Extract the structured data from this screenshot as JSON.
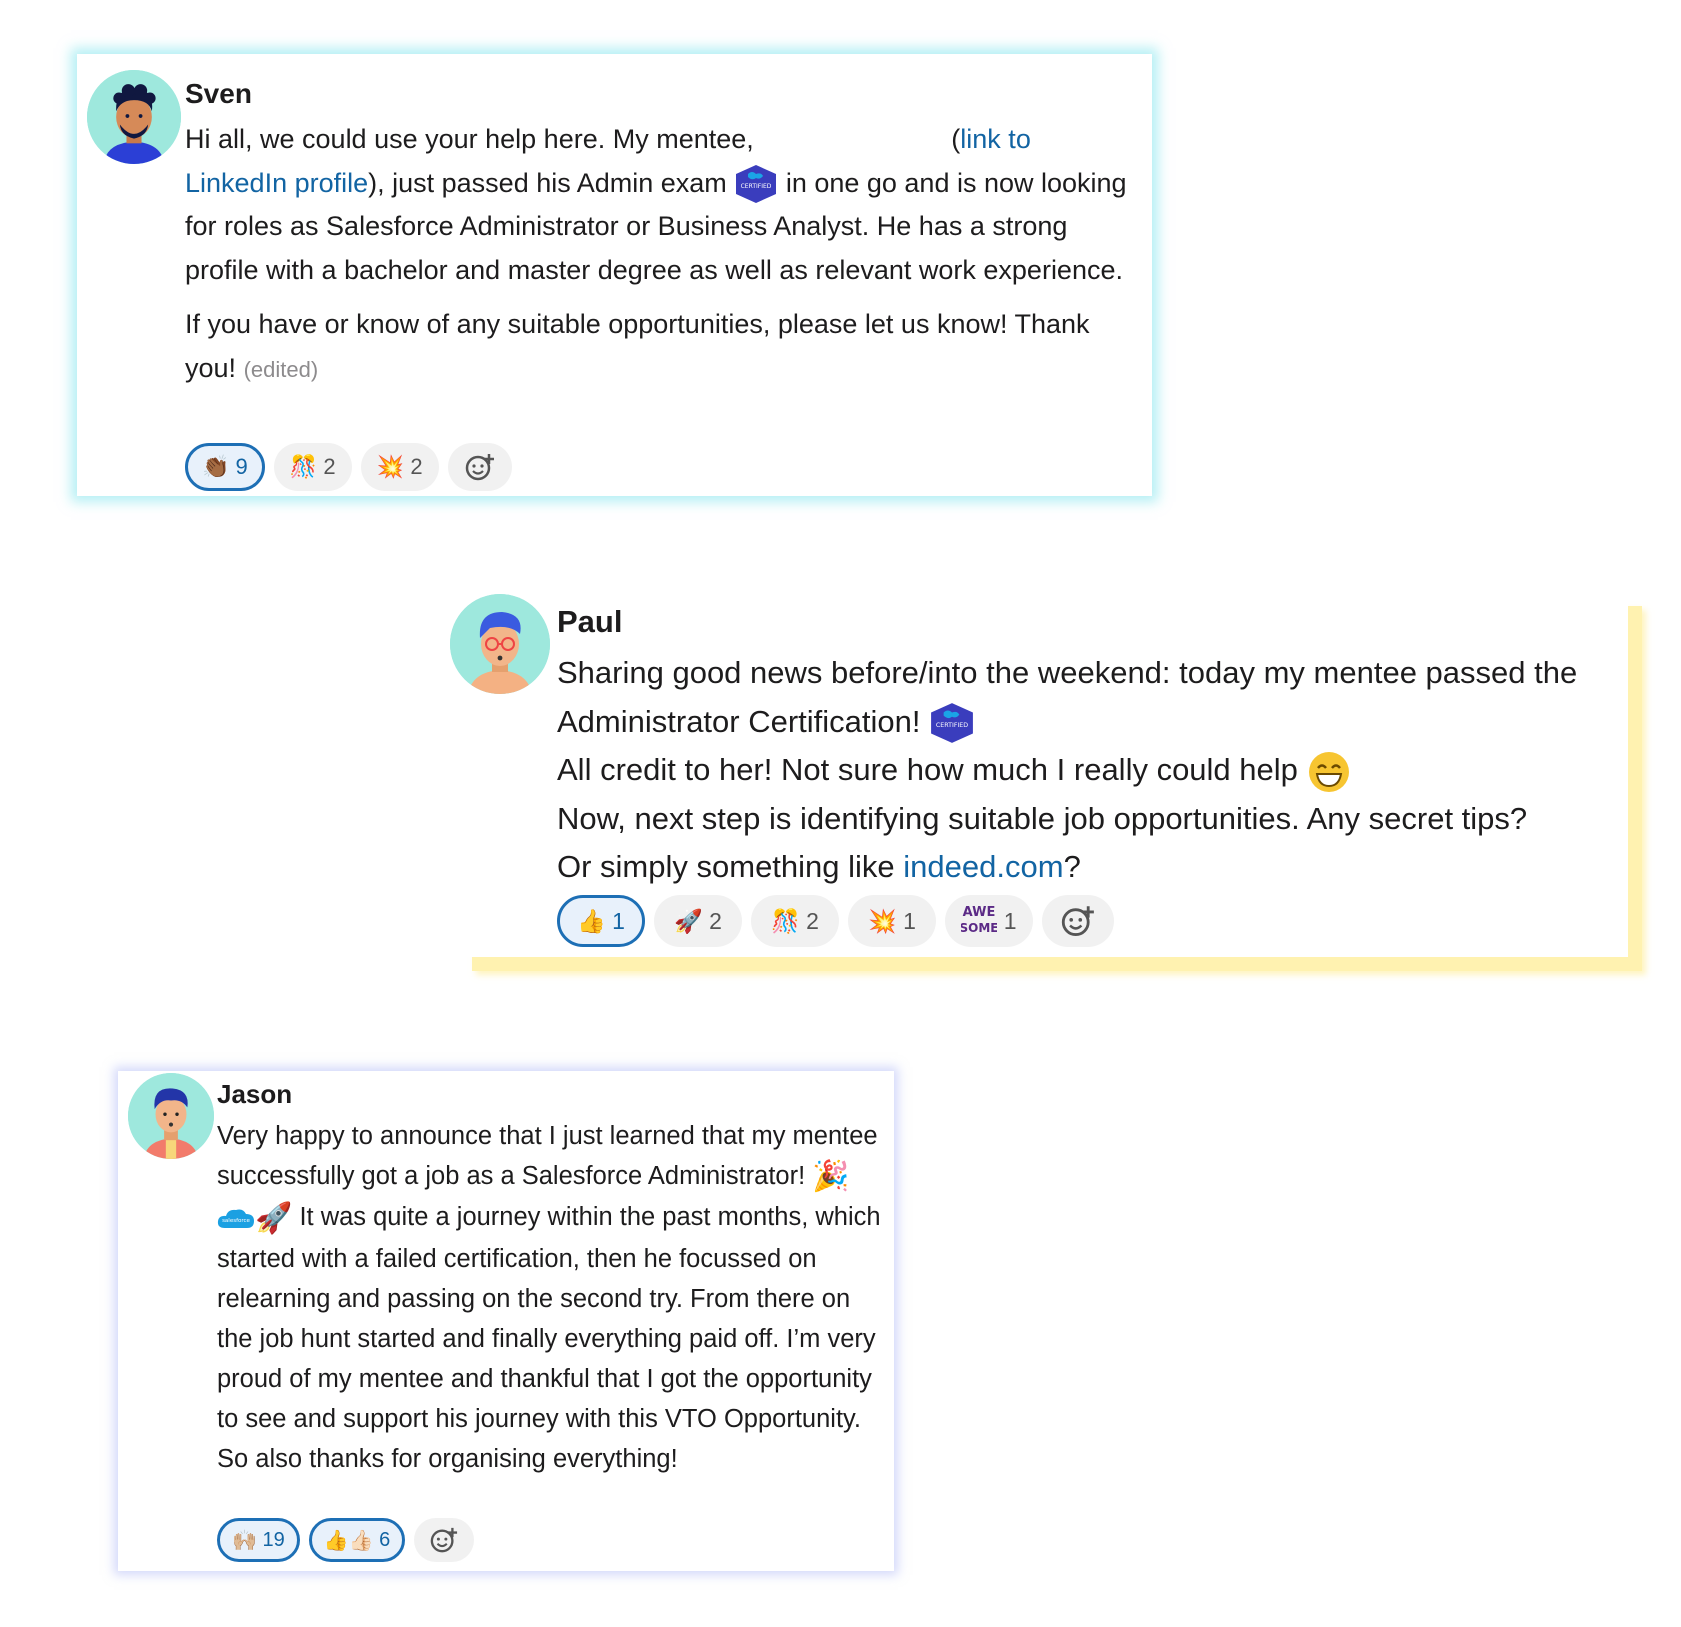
{
  "messages": [
    {
      "author": "Sven",
      "paragraphs": {
        "p1_a": "Hi all, we could use your help here. My mentee",
        "p1_link": "link to LinkedIn profile",
        "p1_b": ", just passed his Admin exam",
        "p1_c": " in one go and is now looking for roles as Salesforce Administrator or Business Analyst. He has a strong profile with a bachelor and master degree as well as relevant work experience.",
        "p2": "If you have or know of any suitable opportunities, please let us know! Thank you!",
        "edited": "(edited)"
      },
      "reactions": [
        {
          "icon": "clap-icon",
          "glyph": "👏🏾",
          "count": "9",
          "active": true
        },
        {
          "icon": "confetti-icon",
          "glyph": "🎊",
          "count": "2",
          "active": false
        },
        {
          "icon": "boom-icon",
          "glyph": "💥",
          "count": "2",
          "active": false
        }
      ]
    },
    {
      "author": "Paul",
      "lines": {
        "l1": "Sharing good news before/into the weekend: today my mentee passed the Administrator Certification!",
        "l2": "All credit to her! Not sure how much I really could help",
        "l3": "Now, next step is identifying suitable job opportunities. Any secret tips?",
        "l4_a": "Or simply something like ",
        "l4_link": "indeed.com",
        "l4_b": "?"
      },
      "reactions": [
        {
          "icon": "thumbs-up-icon",
          "glyph": "👍",
          "count": "1",
          "active": true
        },
        {
          "icon": "rocket-icon",
          "glyph": "🚀",
          "count": "2",
          "active": false
        },
        {
          "icon": "confetti-icon",
          "glyph": "🎊",
          "count": "2",
          "active": false
        },
        {
          "icon": "boom-icon",
          "glyph": "💥",
          "count": "1",
          "active": false
        },
        {
          "icon": "awesome-icon",
          "glyph": "AWESOME",
          "count": "1",
          "active": false
        }
      ]
    },
    {
      "author": "Jason",
      "lines": {
        "a": "Very happy to announce that I just learned that my mentee successfully got a job as a Salesforce Administrator!",
        "b": " It was quite a journey within the past months, which started with a failed certification, then he focussed on relearning and passing on the second try. From there on the job hunt started and finally everything paid off. I’m very proud of my mentee and thankful that I got the opportunity to see and support his journey with this VTO Opportunity. So also thanks for organising everything!"
      },
      "reactions": [
        {
          "icon": "raised-hands-icon",
          "glyph": "🙌🏼",
          "count": "19",
          "active": true
        },
        {
          "icon": "thumbs-up-multi-icon",
          "glyph": "👍👍🏻",
          "count": "6",
          "active": true
        }
      ]
    }
  ],
  "badges": {
    "certified": "CERTIFIED",
    "salesforce": "salesforce"
  },
  "colors": {
    "link": "#1264a3",
    "active_border": "#1d6fb5",
    "sven_glow": "#78e1eb",
    "paul_shadow": "#fff2b0",
    "jason_glow": "#aab4f5"
  }
}
